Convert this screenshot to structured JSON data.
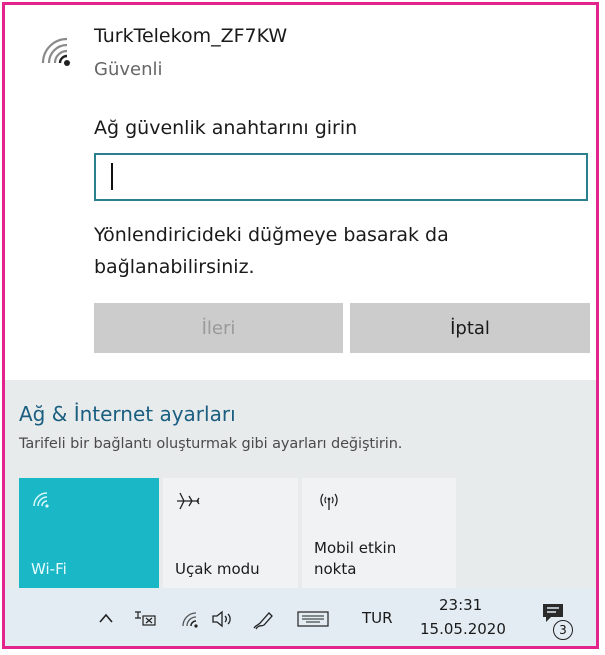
{
  "network": {
    "ssid": "TurkTelekom_ZF7KW",
    "status": "Güvenli",
    "prompt": "Ağ güvenlik anahtarını girin",
    "key_value": "",
    "hint": "Yönlendiricideki düğmeye basarak da bağlanabilirsiniz.",
    "next_label": "İleri",
    "cancel_label": "İptal"
  },
  "settings": {
    "link": "Ağ & İnternet ayarları",
    "description": "Tarifeli bir bağlantı oluşturmak gibi ayarları değiştirin."
  },
  "quick_actions": [
    {
      "label": "Wi-Fi",
      "icon": "wifi-icon",
      "active": true
    },
    {
      "label": "Uçak modu",
      "icon": "airplane-icon",
      "active": false
    },
    {
      "label": "Mobil etkin nokta",
      "icon": "hotspot-icon",
      "active": false
    }
  ],
  "taskbar": {
    "language": "TUR",
    "time": "23:31",
    "date": "15.05.2020",
    "notification_count": "3"
  },
  "colors": {
    "accent": "#1ab7c7",
    "border": "#e2248c",
    "link": "#1a5e80"
  }
}
